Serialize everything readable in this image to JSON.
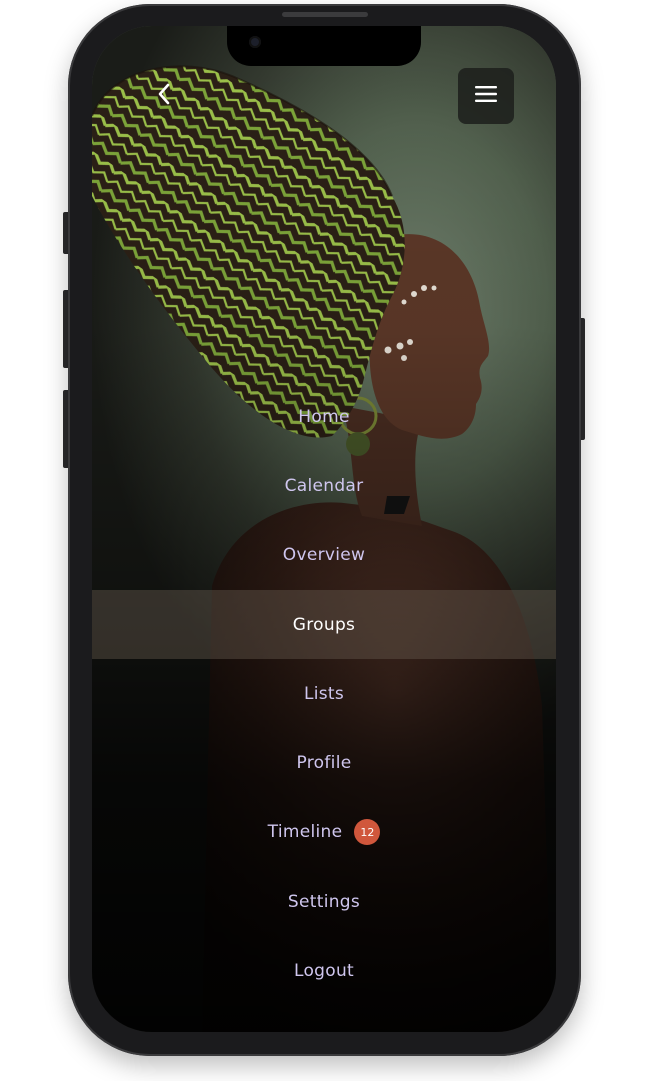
{
  "colors": {
    "menu_text": "#cfc6ee",
    "menu_text_active": "#ffffff",
    "active_row": "#695c52",
    "badge": "#d0573c",
    "headwrap_green": "#9cc14a",
    "headwrap_dark": "#2b2016"
  },
  "header": {
    "back_icon": "chevron-left-icon",
    "menu_icon": "hamburger-menu-icon"
  },
  "nav": {
    "items": [
      {
        "label": "Home",
        "active": false
      },
      {
        "label": "Calendar",
        "active": false
      },
      {
        "label": "Overview",
        "active": false
      },
      {
        "label": "Groups",
        "active": true
      },
      {
        "label": "Lists",
        "active": false
      },
      {
        "label": "Profile",
        "active": false
      },
      {
        "label": "Timeline",
        "active": false,
        "badge": "12"
      },
      {
        "label": "Settings",
        "active": false
      },
      {
        "label": "Logout",
        "active": false
      }
    ]
  }
}
